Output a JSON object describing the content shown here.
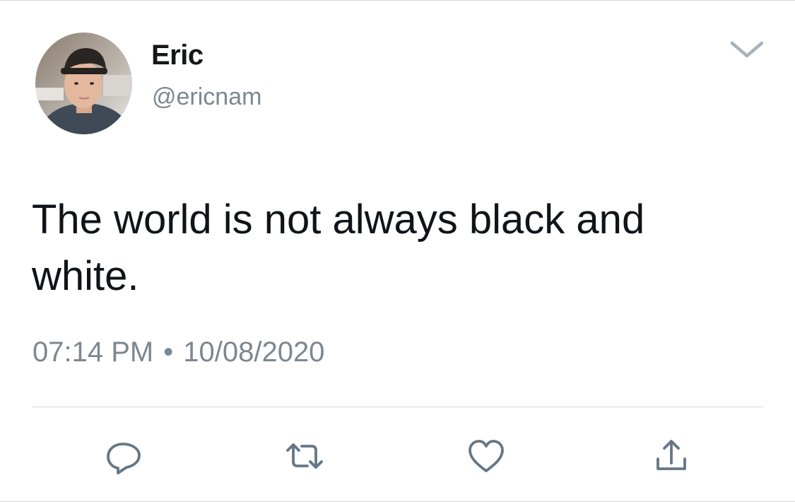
{
  "tweet": {
    "author": {
      "display_name": "Eric",
      "handle": "@ericnam"
    },
    "text": "The world is not always black and white.",
    "timestamp": {
      "time": "07:14 PM",
      "separator": "•",
      "date": "10/08/2020"
    }
  },
  "icons": {
    "menu": "chevron-down-icon",
    "reply": "reply-icon",
    "retweet": "retweet-icon",
    "like": "heart-icon",
    "share": "share-icon"
  },
  "colors": {
    "text_primary": "#14171a",
    "text_secondary": "#7d8790",
    "icon_gray": "#657786",
    "divider": "#d5d8db",
    "background": "#ffffff"
  }
}
